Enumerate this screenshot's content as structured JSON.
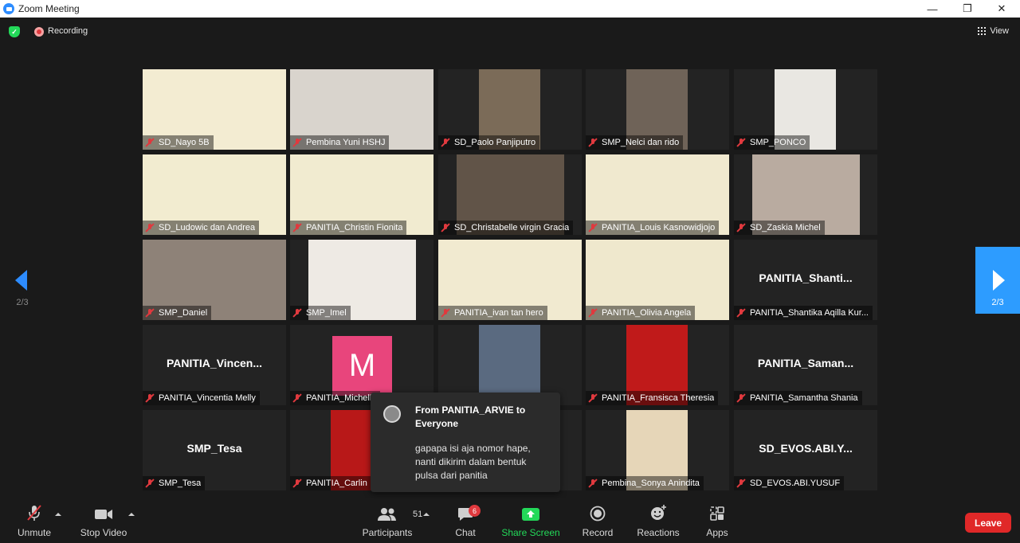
{
  "window": {
    "title": "Zoom Meeting",
    "controls": [
      "—",
      "❐",
      "✕"
    ]
  },
  "topbar": {
    "recording_label": "Recording",
    "view_label": "View"
  },
  "grid": {
    "tiles": [
      {
        "name": "SD_Nayo 5B",
        "kind": "video",
        "bg": "#f3ecd2",
        "vw": 180,
        "vl": 0
      },
      {
        "name": "Pembina Yuni HSHJ",
        "kind": "video",
        "bg": "#d9d4cd",
        "vw": 180,
        "vl": 0
      },
      {
        "name": "SD_Paolo Panjiputro",
        "kind": "video",
        "bg": "#7b6b58",
        "vw": 77,
        "vl": 51
      },
      {
        "name": "SMP_Nelci dan rido",
        "kind": "video",
        "bg": "#6f6358",
        "vw": 77,
        "vl": 51
      },
      {
        "name": "SMP_PONCO",
        "kind": "video",
        "bg": "#e9e7e2",
        "vw": 77,
        "vl": 51
      },
      {
        "name": "SD_Ludowic dan Andrea",
        "kind": "video",
        "bg": "#f2ecd0",
        "vw": 180,
        "vl": 0
      },
      {
        "name": "PANITIA_Christin Fionita",
        "kind": "video",
        "bg": "#f1ebd0",
        "vw": 180,
        "vl": 0
      },
      {
        "name": "SD_Christabelle virgin Gracia",
        "kind": "video",
        "bg": "#615448",
        "vw": 135,
        "vl": 23
      },
      {
        "name": "PANITIA_Louis Kasnowidjojo",
        "kind": "video",
        "bg": "#f0e9cf",
        "vw": 180,
        "vl": 0
      },
      {
        "name": "SD_Zaskia Michel",
        "kind": "video",
        "bg": "#b9aba0",
        "vw": 135,
        "vl": 23
      },
      {
        "name": "SMP_Daniel",
        "kind": "video",
        "bg": "#8e8278",
        "vw": 180,
        "vl": 0
      },
      {
        "name": "SMP_Imel",
        "kind": "video",
        "bg": "#eeeae4",
        "vw": 135,
        "vl": 23
      },
      {
        "name": "PANITIA_ivan tan hero",
        "kind": "video",
        "bg": "#f1ead0",
        "vw": 180,
        "vl": 0
      },
      {
        "name": "PANITIA_Olivia Angela",
        "kind": "video",
        "bg": "#efe8cd",
        "vw": 180,
        "vl": 0
      },
      {
        "name": "PANITIA_Shantika Aqilla Kur...",
        "kind": "name",
        "display": "PANITIA_Shanti..."
      },
      {
        "name": "PANITIA_Vincentia Melly",
        "kind": "name",
        "display": "PANITIA_Vincen..."
      },
      {
        "name": "PANITIA_Michelle",
        "kind": "avatar",
        "letter": "M"
      },
      {
        "name": "",
        "kind": "video",
        "bg": "#5a6a80",
        "vw": 77,
        "vl": 51
      },
      {
        "name": "PANITIA_Fransisca Theresia",
        "kind": "video",
        "bg": "#c01a1a",
        "vw": 77,
        "vl": 51
      },
      {
        "name": "PANITIA_Samantha Shania",
        "kind": "name",
        "display": "PANITIA_Saman..."
      },
      {
        "name": "SMP_Tesa",
        "kind": "name",
        "display": "SMP_Tesa"
      },
      {
        "name": "PANITIA_Carlin",
        "kind": "video",
        "bg": "#b81818",
        "vw": 77,
        "vl": 51
      },
      {
        "name": "",
        "kind": "empty"
      },
      {
        "name": "Pembina_Sonya Anindita",
        "kind": "video",
        "bg": "#e6d6b8",
        "vw": 77,
        "vl": 51
      },
      {
        "name": "SD_EVOS.ABI.YUSUF",
        "kind": "name",
        "display": "SD_EVOS.ABI.Y..."
      }
    ]
  },
  "nav": {
    "left_page": "2/3",
    "right_page": "2/3"
  },
  "chat_popup": {
    "from": "From PANITIA_ARVIE to Everyone",
    "message": "gapapa isi aja nomor hape, nanti dikirim dalam bentuk pulsa dari panitia"
  },
  "toolbar": {
    "unmute": "Unmute",
    "stop_video": "Stop Video",
    "participants": "Participants",
    "participants_count": "51",
    "chat": "Chat",
    "chat_badge": "6",
    "share_screen": "Share Screen",
    "record": "Record",
    "reactions": "Reactions",
    "apps": "Apps",
    "leave": "Leave"
  },
  "colors": {
    "accent": "#2d8cff",
    "share_green": "#23d959",
    "leave_red": "#e02828",
    "muted_red": "#e0393e"
  }
}
